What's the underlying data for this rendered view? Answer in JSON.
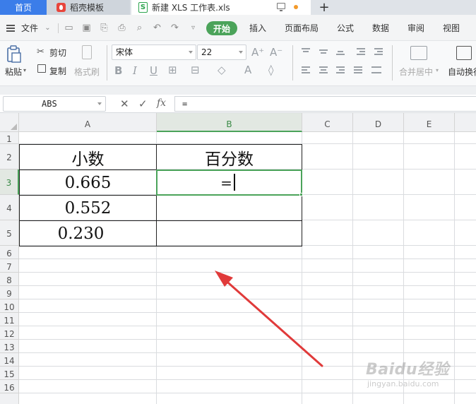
{
  "tabs": {
    "home": "首页",
    "docer": "稻壳模板",
    "file": "新建 XLS 工作表.xls",
    "file_icon": "S",
    "add": "+"
  },
  "menu": {
    "file": "文件",
    "items": [
      "开始",
      "插入",
      "页面布局",
      "公式",
      "数据",
      "审阅",
      "视图"
    ]
  },
  "ribbon": {
    "paste": "粘贴",
    "cut": "剪切",
    "copy": "复制",
    "format_painter": "格式刷",
    "font_name": "宋体",
    "font_size": "22",
    "merge_center": "合并居中",
    "auto_wrap": "自动换行"
  },
  "formula_bar": {
    "name_box": "ABS",
    "fx": "fx",
    "formula": "="
  },
  "sheet": {
    "columns": [
      "A",
      "B",
      "C",
      "D",
      "E"
    ],
    "active_column": "B",
    "rows": [
      "1",
      "2",
      "3",
      "4",
      "5",
      "6",
      "7",
      "8",
      "9",
      "10",
      "11",
      "12",
      "13",
      "14",
      "15",
      "16"
    ],
    "active_row": "3",
    "cells": {
      "A2": "小数",
      "B2": "百分数",
      "A3": "0.665",
      "B3": "=",
      "A4": "0.552",
      "A5": "0.230"
    }
  },
  "watermark": {
    "main": "Baidu经验",
    "sub": "jingyan.baidu.com"
  },
  "colors": {
    "accent_green": "#4ba35a",
    "home_tab_blue": "#3b7de9",
    "arrow_red": "#e03a3a"
  }
}
